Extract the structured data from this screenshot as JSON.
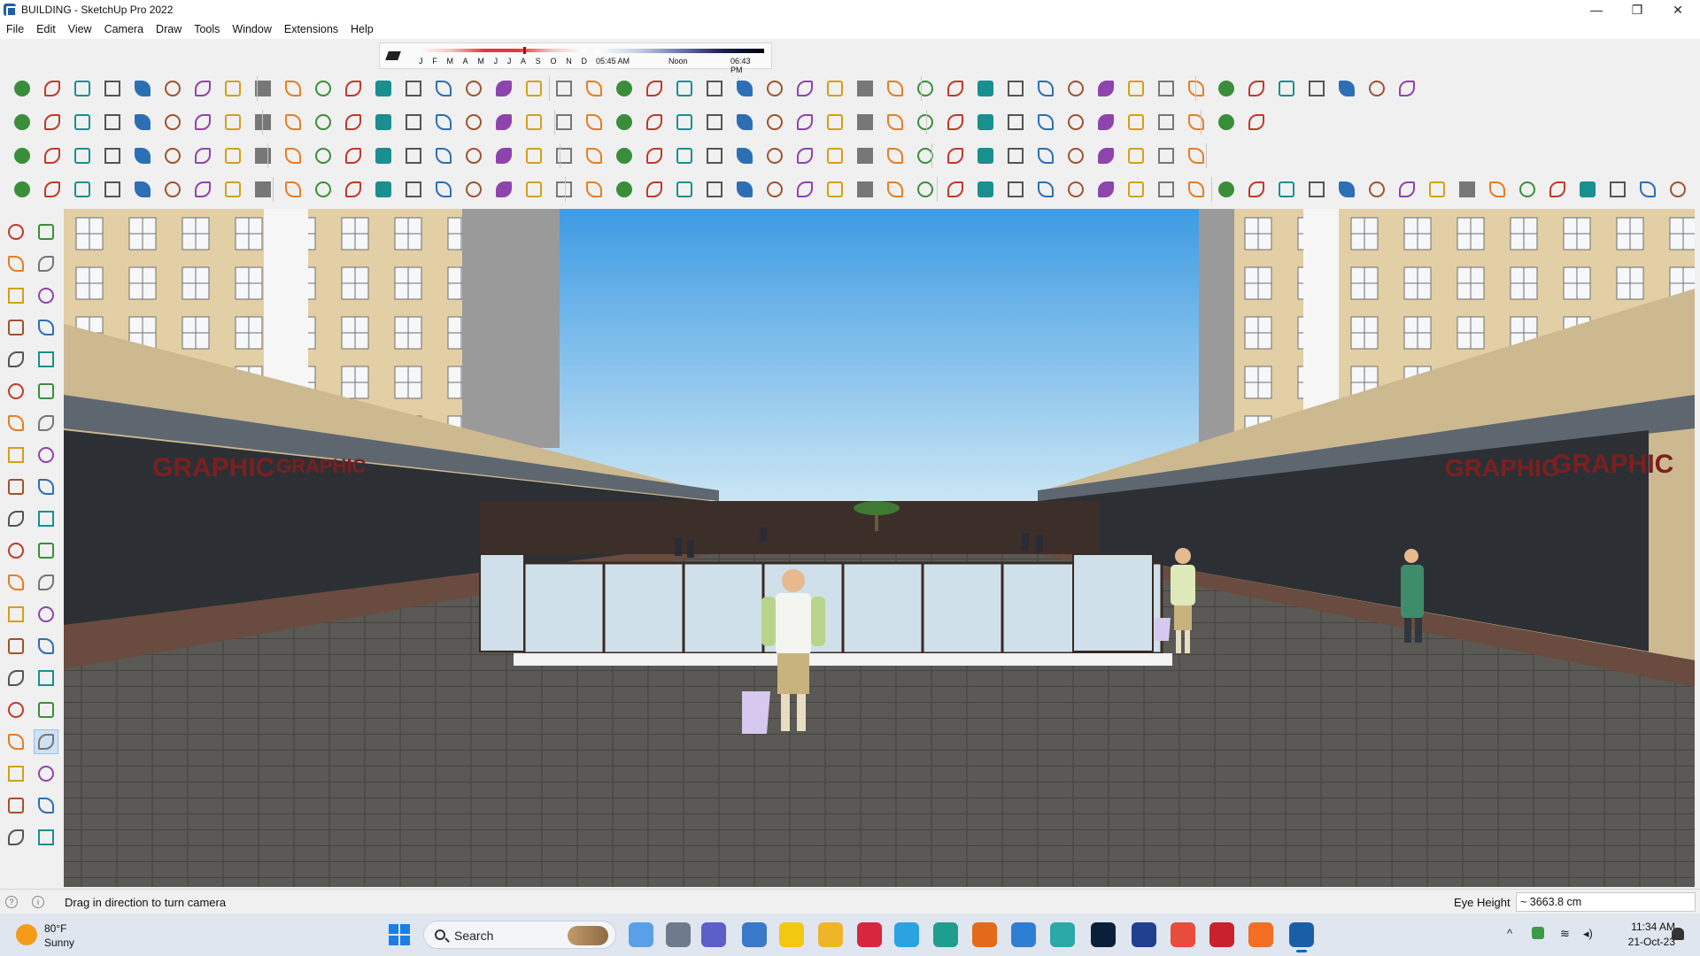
{
  "window": {
    "title": "BUILDING - SketchUp Pro 2022",
    "minimize": "—",
    "restore": "❐",
    "close": "✕"
  },
  "menu": [
    "File",
    "Edit",
    "View",
    "Camera",
    "Draw",
    "Tools",
    "Window",
    "Extensions",
    "Help"
  ],
  "shadows": {
    "months": [
      "J",
      "F",
      "M",
      "A",
      "M",
      "J",
      "J",
      "A",
      "S",
      "O",
      "N",
      "D"
    ],
    "sunrise": "05:45 AM",
    "noon": "Noon",
    "sunset": "06:43 PM"
  },
  "statusbar": {
    "info_icon_1": "?",
    "info_icon_2": "i",
    "message": "Drag in direction to turn camera",
    "measure_label": "Eye Height",
    "measure_value": "~ 3663.8 cm"
  },
  "scene": {
    "sign_text": "GRAPHIC",
    "colors": {
      "sky_top": "#4aa3e6",
      "sky_bottom": "#cfe6f3",
      "building": "#e3cfa6",
      "pavement": "#5c5a56",
      "active_tool": "#cfe2f5"
    }
  },
  "taskbar": {
    "weather_temp": "80°F",
    "weather_desc": "Sunny",
    "search_placeholder": "Search",
    "tray_chevron": "^",
    "clock_time": "11:34 AM",
    "clock_date": "21-Oct-23"
  }
}
